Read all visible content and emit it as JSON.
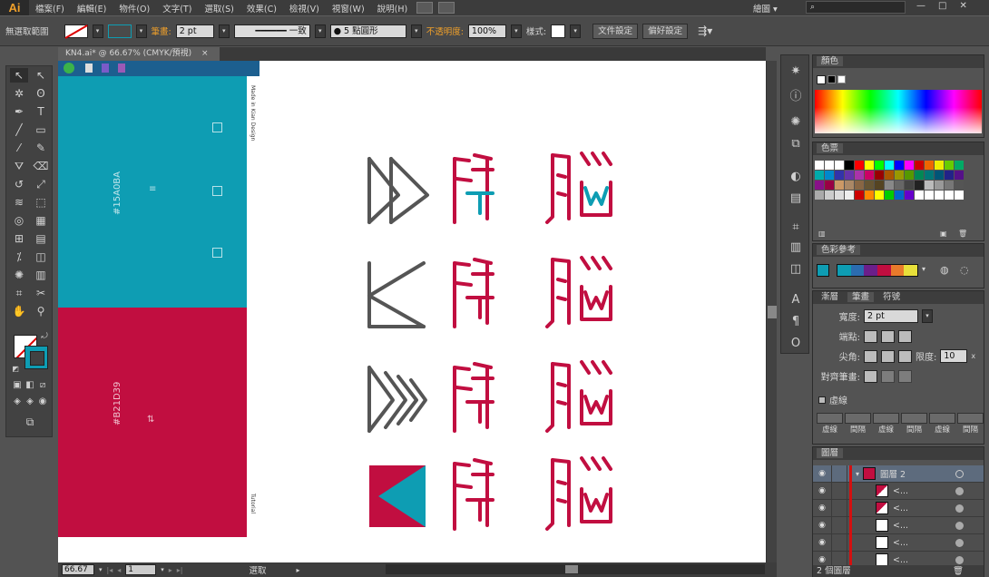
{
  "app": {
    "logo": "Ai"
  },
  "menu": {
    "items": [
      "檔案(F)",
      "編輯(E)",
      "物件(O)",
      "文字(T)",
      "選取(S)",
      "效果(C)",
      "檢視(V)",
      "視窗(W)",
      "說明(H)"
    ],
    "workspace": "繪圖"
  },
  "control": {
    "selection": "無選取範圍",
    "stroke_label": "筆畫:",
    "stroke_value": "2 pt",
    "profile": "一致",
    "brush": "5 點圓形",
    "opacity_label": "不透明度:",
    "opacity_value": "100%",
    "style_label": "樣式:",
    "doc_setup": "文件設定",
    "prefs": "偏好設定"
  },
  "document": {
    "tab": "KN4.ai* @ 66.67% (CMYK/預視)",
    "close": "×"
  },
  "artboard": {
    "blue_color": "#0e9db3",
    "red_color": "#c10e40",
    "blue_code": "#15A0BA",
    "red_code": "#B21D39",
    "strip_top": "Made in Kian Design",
    "strip_bottom": "Tutorial"
  },
  "status": {
    "zoom": "66.67",
    "page": "1",
    "tool": "選取"
  },
  "panels": {
    "color": {
      "title": "顏色"
    },
    "swatches": {
      "title": "色票"
    },
    "guide": {
      "title": "色彩參考"
    },
    "stroke": {
      "tabs": [
        "漸層",
        "筆畫",
        "符號"
      ],
      "width_label": "寬度:",
      "width_value": "2 pt",
      "cap_label": "端點:",
      "corner_label": "尖角:",
      "limit_label": "限度:",
      "limit_value": "10",
      "align_label": "對齊筆畫:",
      "dashed_label": "虛線",
      "dash_labels": [
        "虛線",
        "間隔",
        "虛線",
        "間隔",
        "虛線",
        "間隔"
      ]
    },
    "layers": {
      "title": "圖層",
      "layer_name": "圖層 2",
      "sublayer": "<...",
      "footer": "2 個圖層"
    }
  }
}
